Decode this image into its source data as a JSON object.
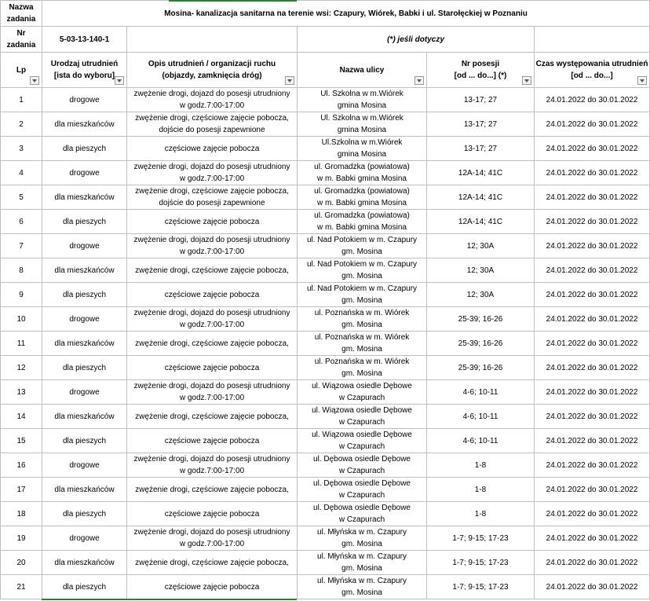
{
  "header": {
    "nazwa_label_1": "Nazwa",
    "nazwa_label_2": "zadania",
    "title": "Mosina- kanalizacja sanitarna na terenie wsi: Czapury, Wiórek, Babki i ul. Starołęckiej w Poznaniu",
    "nr_label_1": "Nr",
    "nr_label_2": "zadania",
    "nr_value": "5-03-13-140-1",
    "note": "(*) jeśli dotyczy"
  },
  "columns": {
    "lp": "Lp",
    "rodzaj_1": "Urodzaj utrudnień",
    "rodzaj_2": "[ista do wyboru]",
    "opis_1": "Opis utrudnień / organizacji ruchu",
    "opis_2": "(objazdy, zamknięcia dróg)",
    "ulica": "Nazwa ulicy",
    "posesja_1": "Nr posesji",
    "posesja_2": "[od ... do...] (*)",
    "czas_1": "Czas występowania utrudnień",
    "czas_2": "[od ... do...]"
  },
  "rows": [
    {
      "lp": "1",
      "rodzaj": "drogowe",
      "opis_1": "zwężenie drogi, dojazd do posesji utrudniony",
      "opis_2": "w godz.7:00-17:00",
      "ulica_1": "Ul. Szkolna  w m.Wiórek",
      "ulica_2": "gmina Mosina",
      "posesja": "13-17; 27",
      "czas": "24.01.2022 do  30.01.2022"
    },
    {
      "lp": "2",
      "rodzaj": "dla mieszkańców",
      "opis_1": "zwężenie drogi, częściowe zajęcie pobocza,",
      "opis_2": "dojście do posesji zapewnione",
      "ulica_1": "Ul. Szkolna  w m.Wiórek",
      "ulica_2": "gmina Mosina",
      "posesja": "13-17; 27",
      "czas": "24.01.2022 do  30.01.2022"
    },
    {
      "lp": "3",
      "rodzaj": "dla pieszych",
      "opis_1": "częściowe zajęcie pobocza",
      "opis_2": "",
      "ulica_1": "Ul.Szkolna  w m.Wiórek",
      "ulica_2": "gmina Mosina",
      "posesja": "13-17; 27",
      "czas": "24.01.2022 do  30.01.2022"
    },
    {
      "lp": "4",
      "rodzaj": "drogowe",
      "opis_1": "zwężenie drogi, dojazd do posesji utrudniony",
      "opis_2": "w godz.7:00-17:00",
      "ulica_1": "ul. Gromadzka (powiatowa)",
      "ulica_2": "w  m. Babki  gmina Mosina",
      "posesja": "12A-14; 41C",
      "czas": "24.01.2022 do  30.01.2022"
    },
    {
      "lp": "5",
      "rodzaj": "dla mieszkańców",
      "opis_1": "zwężenie drogi, częściowe zajęcie pobocza,",
      "opis_2": "dojście do posesji zapewnione",
      "ulica_1": "ul. Gromadzka (powiatowa)",
      "ulica_2": "w  m. Babki  gmina Mosina",
      "posesja": "12A-14; 41C",
      "czas": "24.01.2022 do  30.01.2022"
    },
    {
      "lp": "6",
      "rodzaj": "dla pieszych",
      "opis_1": "częściowe zajęcie pobocza",
      "opis_2": "",
      "ulica_1": "ul. Gromadzka (powiatowa)",
      "ulica_2": "w  m. Babki  gmina Mosina",
      "posesja": "12A-14; 41C",
      "czas": "24.01.2022 do  30.01.2022"
    },
    {
      "lp": "7",
      "rodzaj": "drogowe",
      "opis_1": "zwężenie drogi, dojazd do posesji utrudniony",
      "opis_2": "w godz.7:00-17:00",
      "ulica_1": "ul. Nad Potokiem w m. Czapury",
      "ulica_2": "gm. Mosina",
      "posesja": "12; 30A",
      "czas": "24.01.2022 do  30.01.2022"
    },
    {
      "lp": "8",
      "rodzaj": "dla mieszkańców",
      "opis_1": "zwężenie drogi, częściowe zajęcie pobocza,",
      "opis_2": "",
      "ulica_1": "ul. Nad Potokiem w m. Czapury",
      "ulica_2": "gm. Mosina",
      "posesja": "12; 30A",
      "czas": "24.01.2022 do  30.01.2022"
    },
    {
      "lp": "9",
      "rodzaj": "dla pieszych",
      "opis_1": "częściowe zajęcie pobocza",
      "opis_2": "",
      "ulica_1": "ul. Nad Potokiem w m. Czapury",
      "ulica_2": "gm. Mosina",
      "posesja": "12; 30A",
      "czas": "24.01.2022 do  30.01.2022"
    },
    {
      "lp": "10",
      "rodzaj": "drogowe",
      "opis_1": "zwężenie drogi, dojazd do posesji utrudniony",
      "opis_2": "w godz.7:00-17:00",
      "ulica_1": "ul. Poznańska w m. Wiórek",
      "ulica_2": "gm. Mosina",
      "posesja": "25-39; 16-26",
      "czas": "24.01.2022 do  30.01.2022"
    },
    {
      "lp": "11",
      "rodzaj": "dla mieszkańców",
      "opis_1": "zwężenie drogi, częściowe zajęcie pobocza,",
      "opis_2": "",
      "ulica_1": "ul. Poznańska w m. Wiórek",
      "ulica_2": "gm. Mosina",
      "posesja": "25-39; 16-26",
      "czas": "24.01.2022 do  30.01.2022"
    },
    {
      "lp": "12",
      "rodzaj": "dla pieszych",
      "opis_1": "częściowe zajęcie pobocza",
      "opis_2": "",
      "ulica_1": "ul. Poznańska w m. Wiórek",
      "ulica_2": "gm. Mosina",
      "posesja": "25-39; 16-26",
      "czas": "24.01.2022 do  30.01.2022"
    },
    {
      "lp": "13",
      "rodzaj": "drogowe",
      "opis_1": "zwężenie drogi, dojazd do posesji utrudniony",
      "opis_2": "w godz.7:00-17:00",
      "ulica_1": "ul. Wiązowa osiedle Dębowe",
      "ulica_2": "w Czapurach",
      "posesja": "4-6; 10-11",
      "czas": "24.01.2022 do  30.01.2022"
    },
    {
      "lp": "14",
      "rodzaj": "dla mieszkańców",
      "opis_1": "zwężenie drogi, częściowe zajęcie pobocza,",
      "opis_2": "",
      "ulica_1": "ul. Wiązowa osiedle Dębowe",
      "ulica_2": "w Czapurach",
      "posesja": "4-6; 10-11",
      "czas": "24.01.2022 do  30.01.2022"
    },
    {
      "lp": "15",
      "rodzaj": "dla pieszych",
      "opis_1": "częściowe zajęcie pobocza",
      "opis_2": "",
      "ulica_1": "ul. Wiązowa osiedle Dębowe",
      "ulica_2": "w Czapurach",
      "posesja": "4-6; 10-11",
      "czas": "24.01.2022 do  30.01.2022"
    },
    {
      "lp": "16",
      "rodzaj": "drogowe",
      "opis_1": "zwężenie drogi, dojazd do posesji utrudniony",
      "opis_2": "w godz.7:00-17:00",
      "ulica_1": "ul. Dębowa osiedle Dębowe",
      "ulica_2": "w Czapurach",
      "posesja": "1-8",
      "czas": "24.01.2022 do  30.01.2022"
    },
    {
      "lp": "17",
      "rodzaj": "dla mieszkańców",
      "opis_1": "zwężenie drogi, częściowe zajęcie pobocza,",
      "opis_2": "",
      "ulica_1": "ul. Dębowa osiedle Dębowe",
      "ulica_2": "w Czapurach",
      "posesja": "1-8",
      "czas": "24.01.2022 do  30.01.2022"
    },
    {
      "lp": "18",
      "rodzaj": "dla pieszych",
      "opis_1": "częściowe zajęcie pobocza",
      "opis_2": "",
      "ulica_1": "ul. Dębowa osiedle Dębowe",
      "ulica_2": "w Czapurach",
      "posesja": "1-8",
      "czas": "24.01.2022 do  30.01.2022"
    },
    {
      "lp": "19",
      "rodzaj": "drogowe",
      "opis_1": "zwężenie drogi, dojazd do posesji utrudniony",
      "opis_2": "w godz.7:00-17:00",
      "ulica_1": "ul. Młyńska  w m. Czapury",
      "ulica_2": "gm. Mosina",
      "posesja": "1-7; 9-15; 17-23",
      "czas": "24.01.2022 do  30.01.2022"
    },
    {
      "lp": "20",
      "rodzaj": "dla mieszkańców",
      "opis_1": "zwężenie drogi, częściowe zajęcie pobocza,",
      "opis_2": "",
      "ulica_1": "ul. Młyńska  w m. Czapury",
      "ulica_2": "gm. Mosina",
      "posesja": "1-7; 9-15; 17-23",
      "czas": "24.01.2022 do  30.01.2022"
    },
    {
      "lp": "21",
      "rodzaj": "dla pieszych",
      "opis_1": "częściowe zajęcie pobocza",
      "opis_2": "",
      "ulica_1": "ul. Młyńska  w m. Czapury",
      "ulica_2": "gm. Mosina",
      "posesja": "1-7; 9-15; 17-23",
      "czas": "24.01.2022 do  30.01.2022"
    }
  ]
}
